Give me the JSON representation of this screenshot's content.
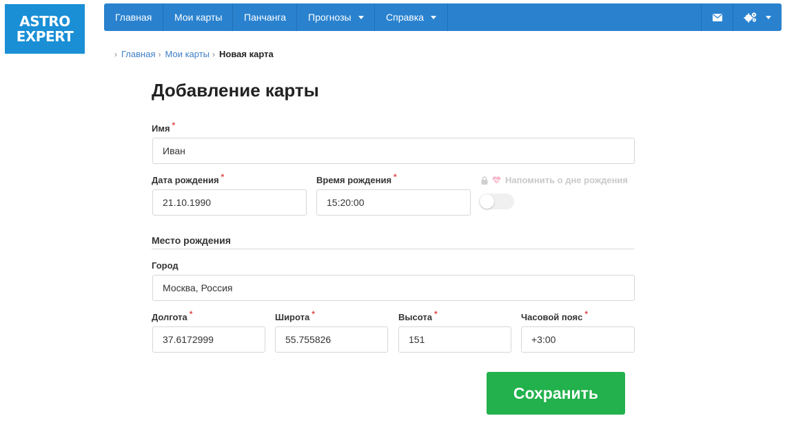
{
  "logo": {
    "line1": "ASTRO",
    "line2": "EXPERT"
  },
  "nav": {
    "items": [
      {
        "label": "Главная"
      },
      {
        "label": "Мои карты"
      },
      {
        "label": "Панчанга"
      },
      {
        "label": "Прогнозы"
      },
      {
        "label": "Справка"
      }
    ],
    "right_icons": [
      "envelope-icon",
      "gears-icon"
    ]
  },
  "breadcrumb": {
    "items": [
      "Главная",
      "Мои карты"
    ],
    "current": "Новая карта"
  },
  "page_title": "Добавление карты",
  "form": {
    "name": {
      "label": "Имя",
      "value": "Иван"
    },
    "birth_date": {
      "label": "Дата рождения",
      "value": "21.10.1990"
    },
    "birth_time": {
      "label": "Время рождения",
      "value": "15:20:00"
    },
    "remind": {
      "label": "Напомнить о дне рождения",
      "enabled": false,
      "locked": true
    },
    "birth_place_section": "Место рождения",
    "city": {
      "label": "Город",
      "value": "Москва, Россия"
    },
    "longitude": {
      "label": "Долгота",
      "value": "37.6172999"
    },
    "latitude": {
      "label": "Широта",
      "value": "55.755826"
    },
    "altitude": {
      "label": "Высота",
      "value": "151"
    },
    "timezone": {
      "label": "Часовой пояс",
      "value": "+3:00"
    },
    "required_mark": "*",
    "save_label": "Сохранить"
  },
  "colors": {
    "nav": "#2a82cf",
    "logo": "#1a8fd6",
    "save": "#22b14c",
    "link": "#3d7ec5",
    "required": "#e04848"
  }
}
